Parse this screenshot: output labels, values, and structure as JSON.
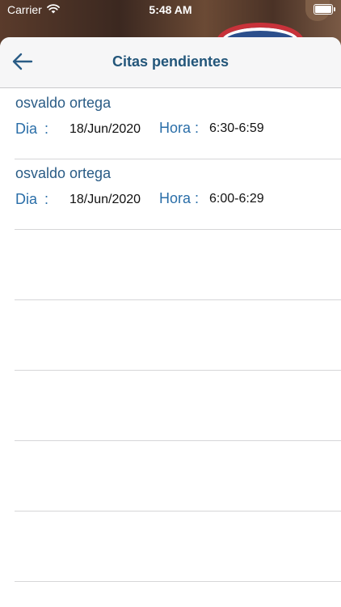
{
  "status_bar": {
    "carrier": "Carrier",
    "time": "5:48 AM",
    "wifi_icon": "wifi-icon",
    "battery_icon": "battery-icon"
  },
  "navbar": {
    "back_icon": "arrow-left-icon",
    "title": "Citas pendientes"
  },
  "appointments": [
    {
      "name": "osvaldo ortega",
      "day_label": "Dia",
      "day_sep": ":",
      "date": "18/Jun/2020",
      "hour_label": "Hora :",
      "hour": "6:30-6:59"
    },
    {
      "name": "osvaldo ortega",
      "day_label": "Dia",
      "day_sep": ":",
      "date": "18/Jun/2020",
      "hour_label": "Hora :",
      "hour": "6:00-6:29"
    }
  ],
  "colors": {
    "title": "#23567a",
    "label": "#2a6ea8",
    "name": "#2a5c86",
    "separator": "#d6d6d8"
  }
}
